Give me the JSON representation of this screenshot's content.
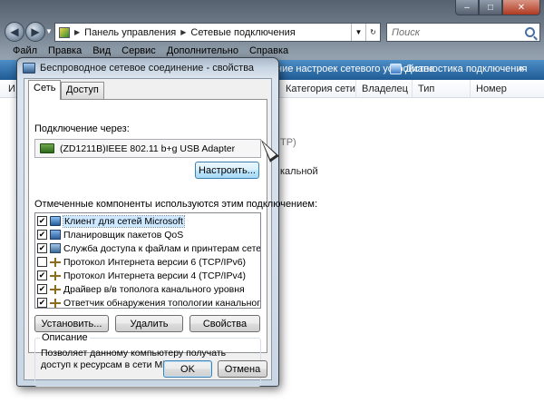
{
  "explorer": {
    "caption_min": "–",
    "caption_max": "□",
    "caption_close": "✕",
    "back_label": "◀",
    "forward_label": "▶",
    "breadcrumb": [
      "Панель управления",
      "Сетевые подключения"
    ],
    "search_placeholder": "Поиск",
    "menu": [
      "Файл",
      "Правка",
      "Вид",
      "Сервис",
      "Дополнительно",
      "Справка"
    ],
    "command_bar": {
      "device_settings": "ние настроек сетевого устройства",
      "diagnose": "Диагностика подключения",
      "more": "»"
    },
    "columns": [
      "Категория сети",
      "Владелец",
      "Тип",
      "Номер телефона..."
    ],
    "col_first_letter": "И",
    "bg_fragment_tp": "TP)",
    "bg_fragment_local": "кальной"
  },
  "dialog": {
    "title": "Беспроводное сетевое соединение - свойства",
    "tabs": [
      "Сеть",
      "Доступ"
    ],
    "connect_using_label": "Подключение через:",
    "adapter": "(ZD1211B)IEEE 802.11 b+g USB Adapter",
    "configure_button": "Настроить...",
    "components_label": "Отмеченные компоненты используются этим подключением:",
    "components": [
      {
        "label": "Клиент для сетей Microsoft",
        "checked": true,
        "icon": "client-icon",
        "selected": true
      },
      {
        "label": "Планировщик пакетов QoS",
        "checked": true,
        "icon": "qos-icon",
        "selected": false
      },
      {
        "label": "Служба доступа к файлам и принтерам сетей Micro...",
        "checked": true,
        "icon": "file-share-icon",
        "selected": false
      },
      {
        "label": "Протокол Интернета версии 6 (TCP/IPv6)",
        "checked": false,
        "icon": "protocol-icon",
        "selected": false
      },
      {
        "label": "Протокол Интернета версии 4 (TCP/IPv4)",
        "checked": true,
        "icon": "protocol-icon",
        "selected": false
      },
      {
        "label": "Драйвер в/в тополога канального уровня",
        "checked": true,
        "icon": "protocol-icon",
        "selected": false
      },
      {
        "label": "Ответчик обнаружения топологии канального уровня",
        "checked": true,
        "icon": "protocol-icon",
        "selected": false
      }
    ],
    "install_button": "Установить...",
    "remove_button": "Удалить",
    "properties_button": "Свойства",
    "description_title": "Описание",
    "description_text": "Позволяет данному компьютеру получать доступ к ресурсам в сети Microsoft.",
    "ok_button": "OK",
    "cancel_button": "Отмена"
  }
}
